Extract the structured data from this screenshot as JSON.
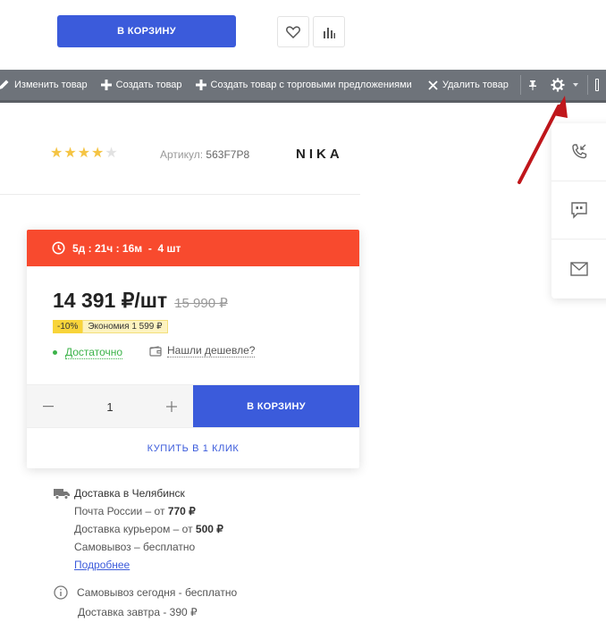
{
  "top": {
    "cart_label": "В КОРЗИНУ"
  },
  "admin_toolbar": {
    "items": [
      {
        "label": "Изменить товар",
        "icon": "pencil-icon"
      },
      {
        "label": "Создать товар",
        "icon": "plus-icon"
      },
      {
        "label": "Создать товар с торговыми предложениями",
        "icon": "plus-icon"
      },
      {
        "label": "Удалить товар",
        "icon": "close-icon"
      }
    ]
  },
  "product": {
    "rating": 4,
    "rating_max": 5,
    "sku_label": "Артикул:",
    "sku_value": "563F7P8",
    "brand": "NIKA"
  },
  "offer": {
    "timer": "5д : 21ч : 16м  -  4 шт",
    "price": "14 391 ₽/шт",
    "old_price": "15 990 ₽",
    "discount": "-10%",
    "saving": "Экономия 1 599 ₽",
    "stock": "Достаточно",
    "cheaper_link": "Нашли дешевле?",
    "quantity": "1",
    "cart_label": "В КОРЗИНУ",
    "one_click_label": "КУПИТЬ В 1 КЛИК"
  },
  "delivery": {
    "title": "Доставка в Челябинск",
    "lines": [
      {
        "name": "Почта России",
        "sep": " – от ",
        "price": "770 ₽"
      },
      {
        "name": "Доставка курьером",
        "sep": " – от ",
        "price": "500 ₽"
      },
      {
        "name": "Самовывоз",
        "sep": " – ",
        "price": "бесплатно"
      }
    ],
    "more_link": "Подробнее",
    "pickup_today": "Самовывоз сегодня - бесплатно",
    "delivery_tomorrow": "Доставка завтра - 390 ₽"
  },
  "colors": {
    "accent": "#3b5bdb",
    "timer_bg": "#f84a2e",
    "admin_bar": "#6e737a",
    "stock_green": "#3cb34a",
    "star": "#f5c443",
    "arrow": "#c0161b"
  }
}
